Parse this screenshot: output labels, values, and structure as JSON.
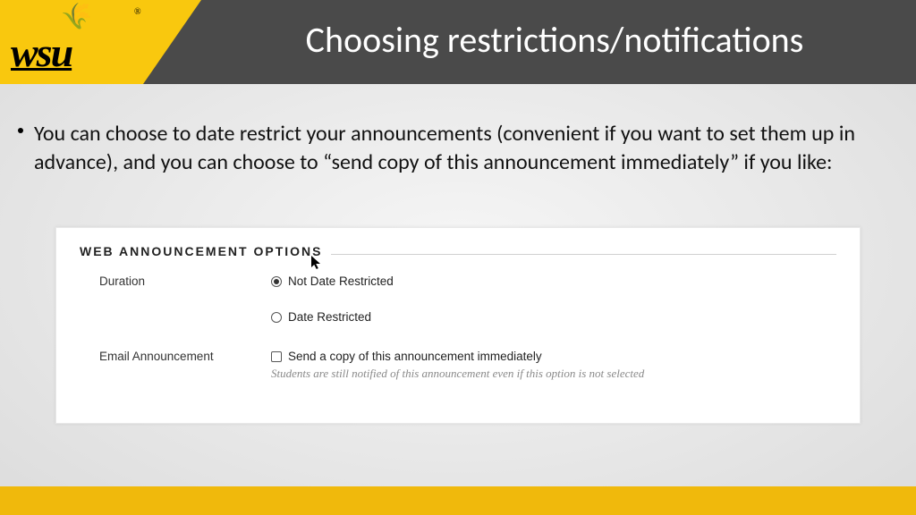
{
  "brand": {
    "logo_text": "wsu",
    "wheat_glyph": "🌾",
    "registered": "®"
  },
  "header": {
    "title": "Choosing restrictions/notifications"
  },
  "body": {
    "bullet_text": "You can choose to date restrict your announcements (convenient if you want to set them up in advance), and you can choose to “send copy of this announcement immediately” if you like:"
  },
  "panel": {
    "title": "WEB ANNOUNCEMENT OPTIONS",
    "cursor_glyph": "✦",
    "duration": {
      "label": "Duration",
      "option_a": "Not Date Restricted",
      "option_b": "Date Restricted",
      "selected": "a"
    },
    "email": {
      "label": "Email Announcement",
      "checkbox_label": "Send a copy of this announcement immediately",
      "checked": false,
      "helper": "Students are still notified of this announcement even if this option is not selected"
    }
  },
  "colors": {
    "brand_yellow": "#f9c80e",
    "header_gray": "#4a4a4a"
  }
}
